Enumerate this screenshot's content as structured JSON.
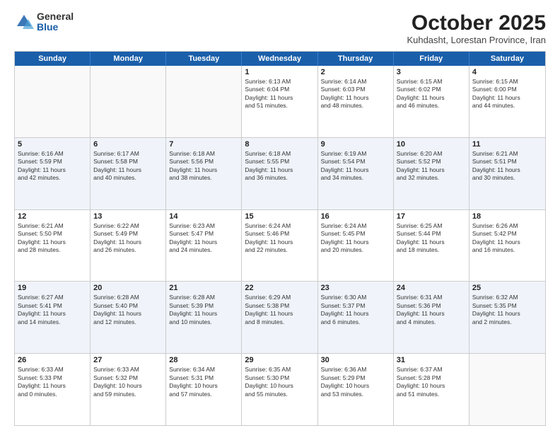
{
  "logo": {
    "general": "General",
    "blue": "Blue"
  },
  "header": {
    "title": "October 2025",
    "subtitle": "Kuhdasht, Lorestan Province, Iran"
  },
  "days": [
    "Sunday",
    "Monday",
    "Tuesday",
    "Wednesday",
    "Thursday",
    "Friday",
    "Saturday"
  ],
  "weeks": [
    [
      {
        "day": "",
        "info": ""
      },
      {
        "day": "",
        "info": ""
      },
      {
        "day": "",
        "info": ""
      },
      {
        "day": "1",
        "info": "Sunrise: 6:13 AM\nSunset: 6:04 PM\nDaylight: 11 hours\nand 51 minutes."
      },
      {
        "day": "2",
        "info": "Sunrise: 6:14 AM\nSunset: 6:03 PM\nDaylight: 11 hours\nand 48 minutes."
      },
      {
        "day": "3",
        "info": "Sunrise: 6:15 AM\nSunset: 6:02 PM\nDaylight: 11 hours\nand 46 minutes."
      },
      {
        "day": "4",
        "info": "Sunrise: 6:15 AM\nSunset: 6:00 PM\nDaylight: 11 hours\nand 44 minutes."
      }
    ],
    [
      {
        "day": "5",
        "info": "Sunrise: 6:16 AM\nSunset: 5:59 PM\nDaylight: 11 hours\nand 42 minutes."
      },
      {
        "day": "6",
        "info": "Sunrise: 6:17 AM\nSunset: 5:58 PM\nDaylight: 11 hours\nand 40 minutes."
      },
      {
        "day": "7",
        "info": "Sunrise: 6:18 AM\nSunset: 5:56 PM\nDaylight: 11 hours\nand 38 minutes."
      },
      {
        "day": "8",
        "info": "Sunrise: 6:18 AM\nSunset: 5:55 PM\nDaylight: 11 hours\nand 36 minutes."
      },
      {
        "day": "9",
        "info": "Sunrise: 6:19 AM\nSunset: 5:54 PM\nDaylight: 11 hours\nand 34 minutes."
      },
      {
        "day": "10",
        "info": "Sunrise: 6:20 AM\nSunset: 5:52 PM\nDaylight: 11 hours\nand 32 minutes."
      },
      {
        "day": "11",
        "info": "Sunrise: 6:21 AM\nSunset: 5:51 PM\nDaylight: 11 hours\nand 30 minutes."
      }
    ],
    [
      {
        "day": "12",
        "info": "Sunrise: 6:21 AM\nSunset: 5:50 PM\nDaylight: 11 hours\nand 28 minutes."
      },
      {
        "day": "13",
        "info": "Sunrise: 6:22 AM\nSunset: 5:49 PM\nDaylight: 11 hours\nand 26 minutes."
      },
      {
        "day": "14",
        "info": "Sunrise: 6:23 AM\nSunset: 5:47 PM\nDaylight: 11 hours\nand 24 minutes."
      },
      {
        "day": "15",
        "info": "Sunrise: 6:24 AM\nSunset: 5:46 PM\nDaylight: 11 hours\nand 22 minutes."
      },
      {
        "day": "16",
        "info": "Sunrise: 6:24 AM\nSunset: 5:45 PM\nDaylight: 11 hours\nand 20 minutes."
      },
      {
        "day": "17",
        "info": "Sunrise: 6:25 AM\nSunset: 5:44 PM\nDaylight: 11 hours\nand 18 minutes."
      },
      {
        "day": "18",
        "info": "Sunrise: 6:26 AM\nSunset: 5:42 PM\nDaylight: 11 hours\nand 16 minutes."
      }
    ],
    [
      {
        "day": "19",
        "info": "Sunrise: 6:27 AM\nSunset: 5:41 PM\nDaylight: 11 hours\nand 14 minutes."
      },
      {
        "day": "20",
        "info": "Sunrise: 6:28 AM\nSunset: 5:40 PM\nDaylight: 11 hours\nand 12 minutes."
      },
      {
        "day": "21",
        "info": "Sunrise: 6:28 AM\nSunset: 5:39 PM\nDaylight: 11 hours\nand 10 minutes."
      },
      {
        "day": "22",
        "info": "Sunrise: 6:29 AM\nSunset: 5:38 PM\nDaylight: 11 hours\nand 8 minutes."
      },
      {
        "day": "23",
        "info": "Sunrise: 6:30 AM\nSunset: 5:37 PM\nDaylight: 11 hours\nand 6 minutes."
      },
      {
        "day": "24",
        "info": "Sunrise: 6:31 AM\nSunset: 5:36 PM\nDaylight: 11 hours\nand 4 minutes."
      },
      {
        "day": "25",
        "info": "Sunrise: 6:32 AM\nSunset: 5:35 PM\nDaylight: 11 hours\nand 2 minutes."
      }
    ],
    [
      {
        "day": "26",
        "info": "Sunrise: 6:33 AM\nSunset: 5:33 PM\nDaylight: 11 hours\nand 0 minutes."
      },
      {
        "day": "27",
        "info": "Sunrise: 6:33 AM\nSunset: 5:32 PM\nDaylight: 10 hours\nand 59 minutes."
      },
      {
        "day": "28",
        "info": "Sunrise: 6:34 AM\nSunset: 5:31 PM\nDaylight: 10 hours\nand 57 minutes."
      },
      {
        "day": "29",
        "info": "Sunrise: 6:35 AM\nSunset: 5:30 PM\nDaylight: 10 hours\nand 55 minutes."
      },
      {
        "day": "30",
        "info": "Sunrise: 6:36 AM\nSunset: 5:29 PM\nDaylight: 10 hours\nand 53 minutes."
      },
      {
        "day": "31",
        "info": "Sunrise: 6:37 AM\nSunset: 5:28 PM\nDaylight: 10 hours\nand 51 minutes."
      },
      {
        "day": "",
        "info": ""
      }
    ]
  ]
}
